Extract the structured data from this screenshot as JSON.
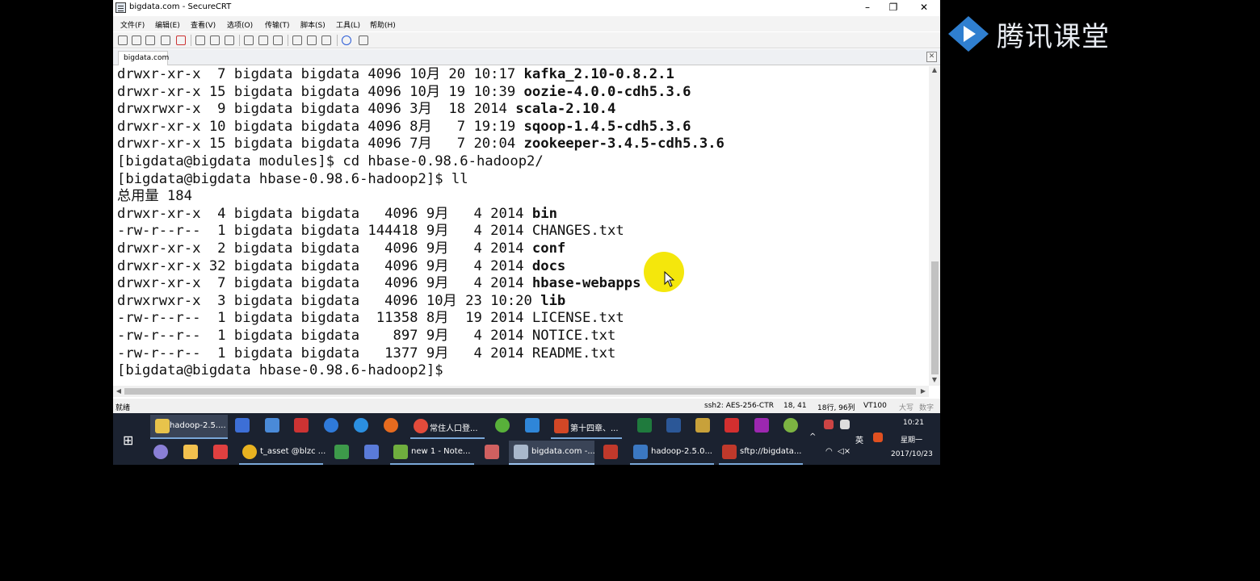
{
  "window": {
    "title": "bigdata.com - SecureCRT",
    "controls": {
      "minimize": "–",
      "maximize": "❐",
      "close": "✕"
    }
  },
  "menu": [
    "文件(F)",
    "编辑(E)",
    "查看(V)",
    "选项(O)",
    "传输(T)",
    "脚本(S)",
    "工具(L)",
    "帮助(H)"
  ],
  "tab": {
    "label": "bigdata.com",
    "close": "✕"
  },
  "terminal": {
    "lines": [
      {
        "prefix": "drwxr-xr-x  7 bigdata bigdata 4096 10月 20 10:17 ",
        "name": "kafka_2.10-0.8.2.1",
        "bold": true
      },
      {
        "prefix": "drwxr-xr-x 15 bigdata bigdata 4096 10月 19 10:39 ",
        "name": "oozie-4.0.0-cdh5.3.6",
        "bold": true
      },
      {
        "prefix": "drwxrwxr-x  9 bigdata bigdata 4096 3月  18 2014 ",
        "name": "scala-2.10.4",
        "bold": true
      },
      {
        "prefix": "drwxr-xr-x 10 bigdata bigdata 4096 8月   7 19:19 ",
        "name": "sqoop-1.4.5-cdh5.3.6",
        "bold": true
      },
      {
        "prefix": "drwxr-xr-x 15 bigdata bigdata 4096 7月   7 20:04 ",
        "name": "zookeeper-3.4.5-cdh5.3.6",
        "bold": true
      },
      {
        "prefix": "[bigdata@bigdata modules]$ cd hbase-0.98.6-hadoop2/",
        "name": "",
        "bold": false
      },
      {
        "prefix": "[bigdata@bigdata hbase-0.98.6-hadoop2]$ ll",
        "name": "",
        "bold": false
      },
      {
        "prefix": "总用量 184",
        "name": "",
        "bold": false
      },
      {
        "prefix": "drwxr-xr-x  4 bigdata bigdata   4096 9月   4 2014 ",
        "name": "bin",
        "bold": true
      },
      {
        "prefix": "-rw-r--r--  1 bigdata bigdata 144418 9月   4 2014 ",
        "name": "CHANGES.txt",
        "bold": false
      },
      {
        "prefix": "drwxr-xr-x  2 bigdata bigdata   4096 9月   4 2014 ",
        "name": "conf",
        "bold": true
      },
      {
        "prefix": "drwxr-xr-x 32 bigdata bigdata   4096 9月   4 2014 ",
        "name": "docs",
        "bold": true
      },
      {
        "prefix": "drwxr-xr-x  7 bigdata bigdata   4096 9月   4 2014 ",
        "name": "hbase-webapps",
        "bold": true
      },
      {
        "prefix": "drwxrwxr-x  3 bigdata bigdata   4096 10月 23 10:20 ",
        "name": "lib",
        "bold": true
      },
      {
        "prefix": "-rw-r--r--  1 bigdata bigdata  11358 8月  19 2014 ",
        "name": "LICENSE.txt",
        "bold": false
      },
      {
        "prefix": "-rw-r--r--  1 bigdata bigdata    897 9月   4 2014 ",
        "name": "NOTICE.txt",
        "bold": false
      },
      {
        "prefix": "-rw-r--r--  1 bigdata bigdata   1377 9月   4 2014 ",
        "name": "README.txt",
        "bold": false
      },
      {
        "prefix": "[bigdata@bigdata hbase-0.98.6-hadoop2]$ ",
        "name": "",
        "bold": false
      }
    ]
  },
  "statusbar": {
    "ready": "就绪",
    "cipher": "ssh2: AES-256-CTR",
    "cursor_pos": "18,  41",
    "size": "18行, 96列",
    "term": "VT100",
    "caps": "大写",
    "num": "数字"
  },
  "taskbar": {
    "top_row": [
      {
        "icon": "folder-icon",
        "label": "hadoop-2.5...."
      },
      {
        "icon": "chrome-icon",
        "label": "常住人口登..."
      },
      {
        "icon": "powerpoint-icon",
        "label": "第十四章、..."
      }
    ],
    "bottom_row": [
      {
        "icon": "asset-icon",
        "label": "t_asset @blzc ..."
      },
      {
        "icon": "notepad-icon",
        "label": "new  1 - Note..."
      },
      {
        "icon": "securecrt-icon",
        "label": "bigdata.com -..."
      },
      {
        "icon": "vbox-icon",
        "label": "hadoop-2.5.0..."
      },
      {
        "icon": "filezilla-icon",
        "label": "sftp://bigdata..."
      }
    ],
    "tray": {
      "lang": "英",
      "time": "10:21",
      "weekday": "星期一",
      "date": "2017/10/23"
    }
  },
  "watermark": {
    "text": "腾讯课堂",
    "icon": "play-logo-icon"
  },
  "colors": {
    "taskbar": "#1b2230",
    "highlight_cursor": "#f4e600",
    "window_bg": "#ffffff",
    "page_bg": "#000000"
  }
}
